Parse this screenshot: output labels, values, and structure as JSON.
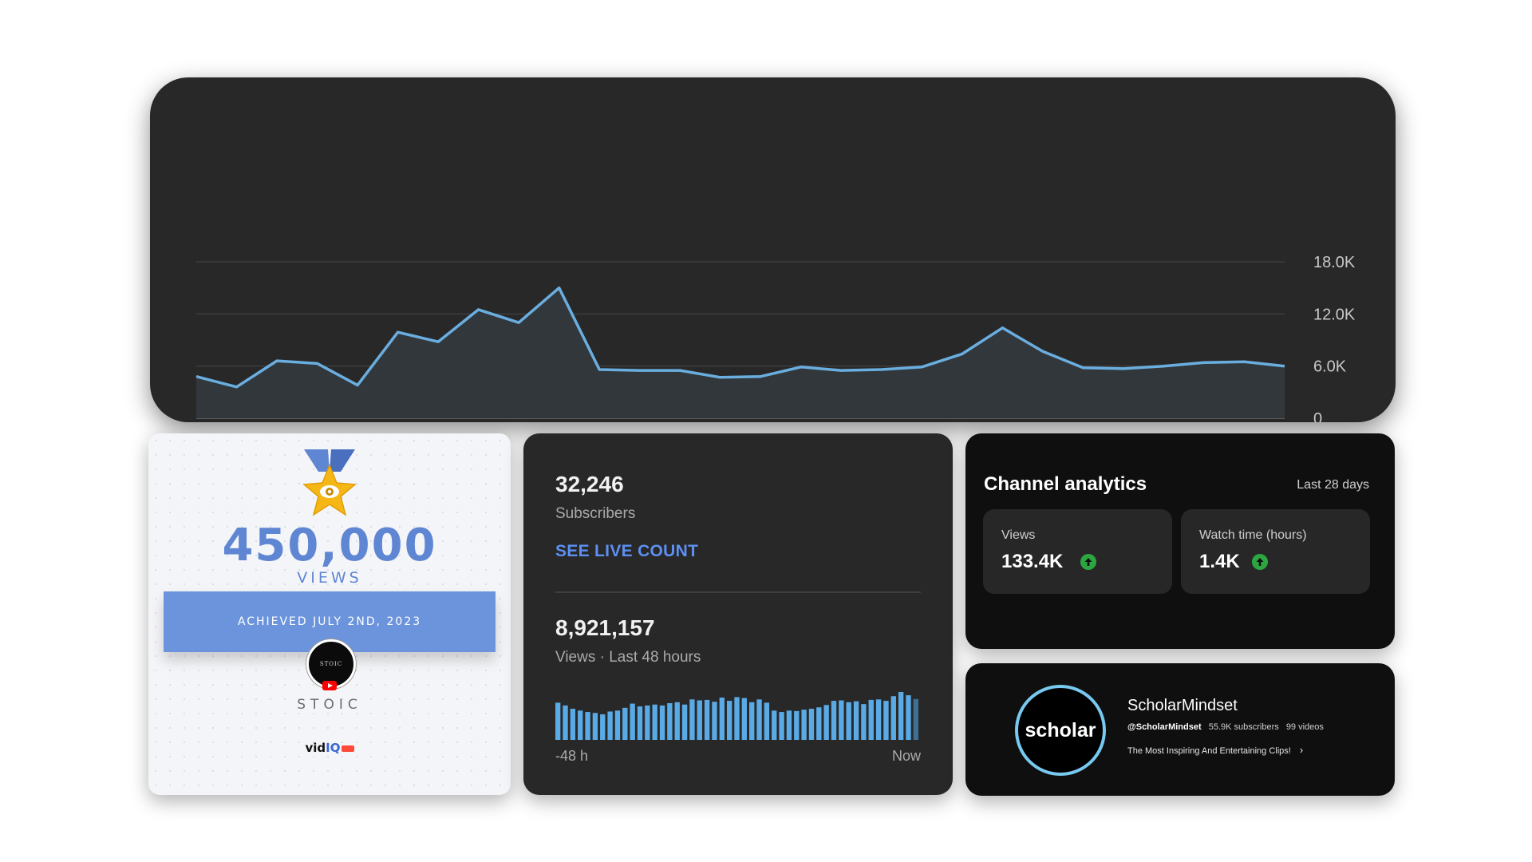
{
  "views_trend": {
    "y_ticks": [
      "18.0K",
      "12.0K",
      "6.0K",
      "0"
    ],
    "line_color": "#6aaee0",
    "chart_data": {
      "type": "area",
      "ylim": [
        0,
        18000
      ],
      "grid": true,
      "values": [
        4800,
        3600,
        6600,
        6300,
        3800,
        9900,
        8800,
        12500,
        11000,
        15000,
        5600,
        5500,
        5500,
        4700,
        4800,
        5900,
        5500,
        5600,
        5900,
        7400,
        10400,
        7700,
        5800,
        5700,
        6000,
        6400,
        6500,
        6000
      ]
    }
  },
  "milestone": {
    "views_number": "450,000",
    "views_word": "VIEWS",
    "achieved_text": "ACHIEVED JULY 2ND, 2023",
    "channel_name": "STOIC",
    "avatar_text": "STOIC",
    "brand_vid": "vid",
    "brand_iq": "IQ",
    "accent_color": "#6b94dc"
  },
  "realtime": {
    "subscribers_count": "32,246",
    "subscribers_label": "Subscribers",
    "live_count_link": "SEE LIVE COUNT",
    "views_count": "8,921,157",
    "views_label": "Views · Last 48 hours",
    "axis_start": "-48 h",
    "axis_end": "Now",
    "bar_color": "#5aaae6",
    "chart_data": {
      "type": "bar",
      "ylim": [
        0,
        100
      ],
      "values": [
        80,
        74,
        67,
        63,
        60,
        58,
        55,
        61,
        63,
        69,
        78,
        72,
        74,
        76,
        74,
        79,
        81,
        76,
        87,
        85,
        86,
        82,
        91,
        84,
        92,
        90,
        81,
        87,
        80,
        63,
        60,
        63,
        62,
        65,
        67,
        70,
        75,
        84,
        85,
        81,
        83,
        77,
        86,
        87,
        84,
        94,
        103,
        96,
        88
      ]
    }
  },
  "analytics": {
    "title": "Channel analytics",
    "period": "Last 28 days",
    "metrics": [
      {
        "label": "Views",
        "value": "133.4K",
        "trend_icon": "arrow-up-circle-icon"
      },
      {
        "label": "Watch time (hours)",
        "value": "1.4K",
        "trend_icon": "arrow-up-circle-icon"
      }
    ],
    "trend_color": "#2ba640"
  },
  "channel": {
    "avatar_text": "scholar",
    "name": "ScholarMindset",
    "handle": "@ScholarMindset",
    "subscribers": "55.9K subscribers",
    "videos": "99 videos",
    "description": "The Most Inspiring And Entertaining Clips!",
    "ring_color": "#78c9f0"
  }
}
